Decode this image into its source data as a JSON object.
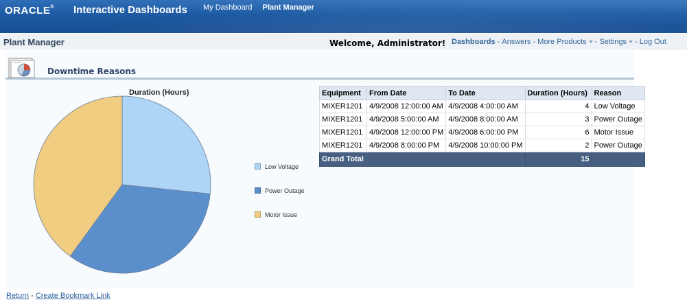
{
  "header": {
    "brand": "ORACLE",
    "app_title": "Interactive Dashboards",
    "nav": [
      {
        "label": "My Dashboard"
      },
      {
        "label": "Plant Manager"
      }
    ]
  },
  "subheader": {
    "page_title": "Plant Manager",
    "welcome": "Welcome, Administrator!",
    "links": {
      "dashboards": "Dashboards",
      "answers": "Answers",
      "more_products": "More Products",
      "settings": "Settings",
      "log_out": "Log Out"
    }
  },
  "section": {
    "title": "Downtime Reasons"
  },
  "chart_data": {
    "type": "pie",
    "title": "Duration (Hours)",
    "categories": [
      "Low Voltage",
      "Power Outage",
      "Motor Issue"
    ],
    "values": [
      4,
      5,
      6
    ],
    "colors": [
      "#aed4f6",
      "#5b8fcc",
      "#f1cd82"
    ],
    "legend": "right"
  },
  "table": {
    "headers": [
      "Equipment",
      "From Date",
      "To Date",
      "Duration (Hours)",
      "Reason"
    ],
    "rows": [
      [
        "MIXER1201",
        "4/9/2008 12:00:00 AM",
        "4/9/2008 4:00:00 AM",
        "4",
        "Low Voltage"
      ],
      [
        "MIXER1201",
        "4/9/2008 5:00:00 AM",
        "4/9/2008 8:00:00 AM",
        "3",
        "Power Outage"
      ],
      [
        "MIXER1201",
        "4/9/2008 12:00:00 PM",
        "4/9/2008 6:00:00 PM",
        "6",
        "Motor Issue"
      ],
      [
        "MIXER1201",
        "4/9/2008 8:00:00 PM",
        "4/9/2008 10:00:00 PM",
        "2",
        "Power Outage"
      ]
    ],
    "total_label": "Grand Total",
    "total_value": "15"
  },
  "footer": {
    "return": "Return",
    "bookmark": "Create Bookmark Link"
  }
}
